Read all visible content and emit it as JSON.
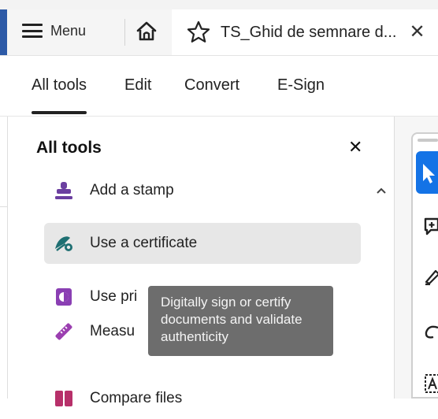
{
  "tabbar": {
    "menu_label": "Menu",
    "document_tab_title": "TS_Ghid de semnare d...",
    "close_symbol": "✕"
  },
  "toolbar": {
    "tabs": [
      "All tools",
      "Edit",
      "Convert",
      "E-Sign"
    ],
    "active_tab": "All tools"
  },
  "panel": {
    "title": "All tools",
    "close_symbol": "✕",
    "items": [
      {
        "label": "Add a stamp",
        "icon": "stamp-icon"
      },
      {
        "label": "Use a certificate",
        "icon": "certificate-icon"
      },
      {
        "label": "Use pri",
        "icon": "print-production-icon"
      },
      {
        "label": "Measu",
        "icon": "ruler-icon"
      },
      {
        "label": "Compare files",
        "icon": "compare-files-icon"
      }
    ]
  },
  "tooltip": {
    "lines": [
      "Digitally sign or certify",
      "documents and validate",
      "authenticity"
    ]
  },
  "colors": {
    "accent_blue": "#1473e6",
    "window_accent": "#2d5aa7",
    "stamp_purple": "#6b3fa0",
    "certificate_teal": "#1e6f72",
    "print_purple": "#8a3fb3",
    "measure_purple": "#9b3fb0",
    "compare_pink": "#b7306a",
    "tooltip_bg": "#6d6d6d"
  }
}
